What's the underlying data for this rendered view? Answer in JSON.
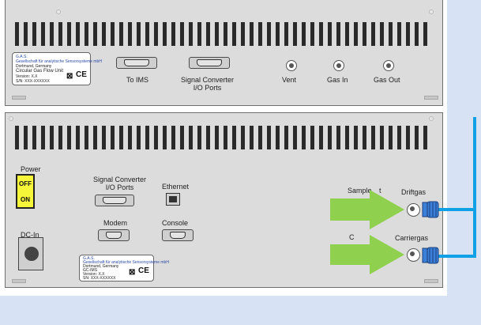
{
  "colors": {
    "background": "#d7e2f4",
    "panel": "#dcdcdc",
    "arrow": "#8fd14f",
    "gas_line": "#0fa0e6",
    "connector": "#3a7fd8",
    "power_switch": "#f5f53a"
  },
  "top_panel": {
    "label_plate": {
      "line1": "G.A.S.",
      "line2": "Gesellschaft für analytische Sensorsysteme mbH",
      "line3": "Dortmund, Germany",
      "line4": "Circular Gas Flow Unit",
      "line5": "Version: X.X",
      "line6": "S/N: XXX-XXXXXX"
    },
    "ports": {
      "to_ims": "To IMS",
      "signal_converter": "Signal Converter",
      "signal_converter_sub": "I/O Ports",
      "vent": "Vent",
      "gas_in": "Gas In",
      "gas_out": "Gas Out"
    }
  },
  "bottom_panel": {
    "power_label": "Power",
    "switch_off": "OFF",
    "switch_on": "ON",
    "dc_in": "DC-In",
    "signal_converter": "Signal Converter",
    "signal_converter_sub": "I/O Ports",
    "ethernet": "Ethernet",
    "modem": "Modem",
    "console": "Console",
    "sample_partial": "Sample",
    "sample_tail": "t",
    "carrier_partial": "C",
    "driftgas": "Driftgas",
    "carriergas": "Carriergas",
    "label_plate": {
      "line1": "G.A.S.",
      "line2": "Gesellschaft für analytische Sensorsysteme mbH",
      "line3": "Dortmund, Germany",
      "line4": "GC-IMS",
      "line5": "Version: X.X",
      "line6": "SN: XXX-XXXXXX"
    }
  }
}
